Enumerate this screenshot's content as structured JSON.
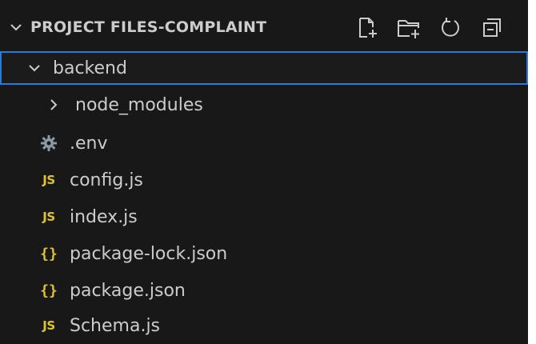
{
  "explorer": {
    "section_title": "PROJECT FILES-COMPLAINT",
    "actions": [
      {
        "name": "new-file-icon"
      },
      {
        "name": "new-folder-icon"
      },
      {
        "name": "refresh-icon"
      },
      {
        "name": "collapse-all-icon"
      }
    ],
    "tree": [
      {
        "label": "backend",
        "type": "folder",
        "expanded": true,
        "icon": "chevron-down-icon",
        "selected": true
      },
      {
        "label": "node_modules",
        "type": "folder",
        "expanded": false,
        "icon": "chevron-right-icon"
      },
      {
        "label": ".env",
        "type": "file",
        "icon": "gear-icon"
      },
      {
        "label": "config.js",
        "type": "file",
        "icon": "js-icon",
        "badge": "JS"
      },
      {
        "label": "index.js",
        "type": "file",
        "icon": "js-icon",
        "badge": "JS"
      },
      {
        "label": "package-lock.json",
        "type": "file",
        "icon": "json-icon",
        "badge": "{}"
      },
      {
        "label": "package.json",
        "type": "file",
        "icon": "json-icon",
        "badge": "{}"
      },
      {
        "label": "Schema.js",
        "type": "file",
        "icon": "js-icon",
        "badge": "JS"
      }
    ]
  },
  "colors": {
    "background": "#181818",
    "text": "#cccccc",
    "selection_border": "#2b7bd6",
    "js_badge": "#e0c330",
    "gear": "#8c9aa6"
  }
}
